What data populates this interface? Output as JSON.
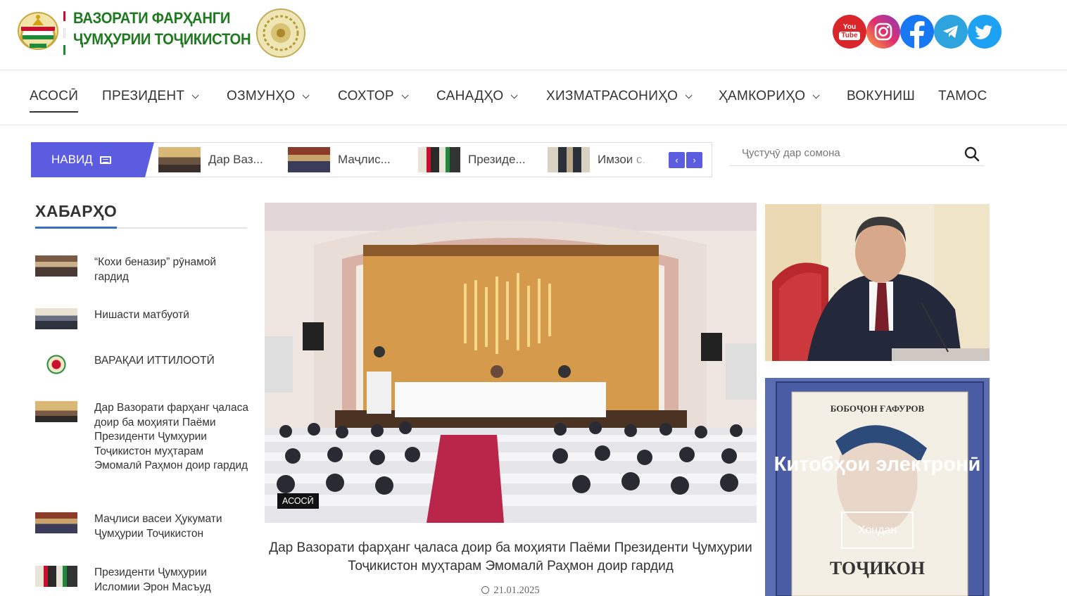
{
  "header": {
    "logo_line1": "ВАЗОРАТИ ФАРҲАНГИ",
    "logo_line2": "ҶУМҲУРИИ ТОҶИКИСТОН",
    "socials": [
      {
        "name": "youtube-icon",
        "label": "You Tube",
        "color": "#d9262a"
      },
      {
        "name": "instagram-icon",
        "label": "",
        "color": "#d6266f"
      },
      {
        "name": "facebook-icon",
        "label": "f",
        "color": "#1877f2"
      },
      {
        "name": "telegram-icon",
        "label": "",
        "color": "#2ea4de"
      },
      {
        "name": "twitter-icon",
        "label": "",
        "color": "#1da1f2"
      }
    ]
  },
  "nav": {
    "items": [
      {
        "label": "АСОСӢ",
        "dropdown": false,
        "active": true
      },
      {
        "label": "ПРЕЗИДЕНТ",
        "dropdown": true
      },
      {
        "label": "ОЗМУНҲО",
        "dropdown": true
      },
      {
        "label": "СОХТОР",
        "dropdown": true
      },
      {
        "label": "САНАДҲО",
        "dropdown": true
      },
      {
        "label": "ХИЗМАТРАСОНИҲО",
        "dropdown": true
      },
      {
        "label": "ҲАМКОРИҲО",
        "dropdown": true
      },
      {
        "label": "ВОКУНИШ",
        "dropdown": false
      },
      {
        "label": "ТАМОС",
        "dropdown": false
      }
    ]
  },
  "ticker": {
    "label": "НАВИД",
    "items": [
      "Дар Ваз...",
      "Маҷлис...",
      "Президе...",
      "Имзои с..."
    ],
    "prev": "‹",
    "next": "›",
    "accent": "#5b5ce0"
  },
  "search": {
    "placeholder": "Ҷустуҷӯ дар сомона"
  },
  "news": {
    "title": "ХАБАРҲО",
    "items": [
      "“Кохи беназир” рӯнамой гардид",
      "Нишасти матбуотӣ",
      "ВАРАҚАИ ИТТИЛООТӢ",
      "Дар Вазорати фарҳанг ҷаласа доир ба моҳияти  Паёми Президенти Ҷумҳурии Тоҷикистон муҳтарам Эмомалӣ Раҳмон доир гардид",
      "Маҷлиси васеи Ҳукумати Ҷумҳурии Тоҷикистон",
      "Президенти Ҷумҳурии Исломии Эрон Масъуд"
    ]
  },
  "feature": {
    "badge": "АСОСӢ",
    "caption": "Дар Вазорати фарҳанг ҷаласа доир ба моҳияти  Паёми Президенти Ҷумҳурии Тоҷикистон муҳтарам Эмомалӣ Раҳмон доир гардид",
    "date": "21.01.2025"
  },
  "ebook": {
    "author": "БОБОҶОН ҒАФУРОВ",
    "book": "ТОҶИКОН",
    "title": "Китобҳои электронӣ",
    "button": "Хондан"
  }
}
